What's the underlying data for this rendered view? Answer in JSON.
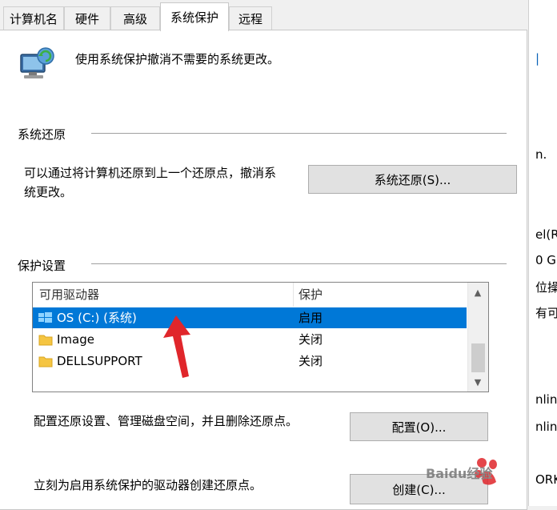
{
  "tabs": [
    {
      "label": "计算机名"
    },
    {
      "label": "硬件"
    },
    {
      "label": "高级"
    },
    {
      "label": "系统保护"
    },
    {
      "label": "远程"
    }
  ],
  "header": {
    "description": "使用系统保护撤消不需要的系统更改。"
  },
  "restore": {
    "title": "系统还原",
    "desc_line1": "可以通过将计算机还原到上一个还原点，撤消系",
    "desc_line2": "统更改。",
    "button": "系统还原(S)..."
  },
  "protection": {
    "title": "保护设置",
    "col_drive": "可用驱动器",
    "col_protect": "保护",
    "rows": [
      {
        "name": "OS (C:) (系统)",
        "status": "启用",
        "icon": "system-drive-icon"
      },
      {
        "name": "Image",
        "status": "关闭",
        "icon": "folder-icon"
      },
      {
        "name": "DELLSUPPORT",
        "status": "关闭",
        "icon": "folder-icon"
      }
    ],
    "config_desc": "配置还原设置、管理磁盘空间，并且删除还原点。",
    "config_button": "配置(O)...",
    "create_desc": "立刻为启用系统保护的驱动器创建还原点。",
    "create_button": "创建(C)..."
  },
  "background_text": [
    "n.",
    "el(R",
    "0 G",
    "位操",
    "有可",
    "nlin",
    "nlin",
    "ORK"
  ],
  "watermark": "Baidu经验",
  "colors": {
    "selection": "#0078d7",
    "arrow": "#e0262b"
  }
}
